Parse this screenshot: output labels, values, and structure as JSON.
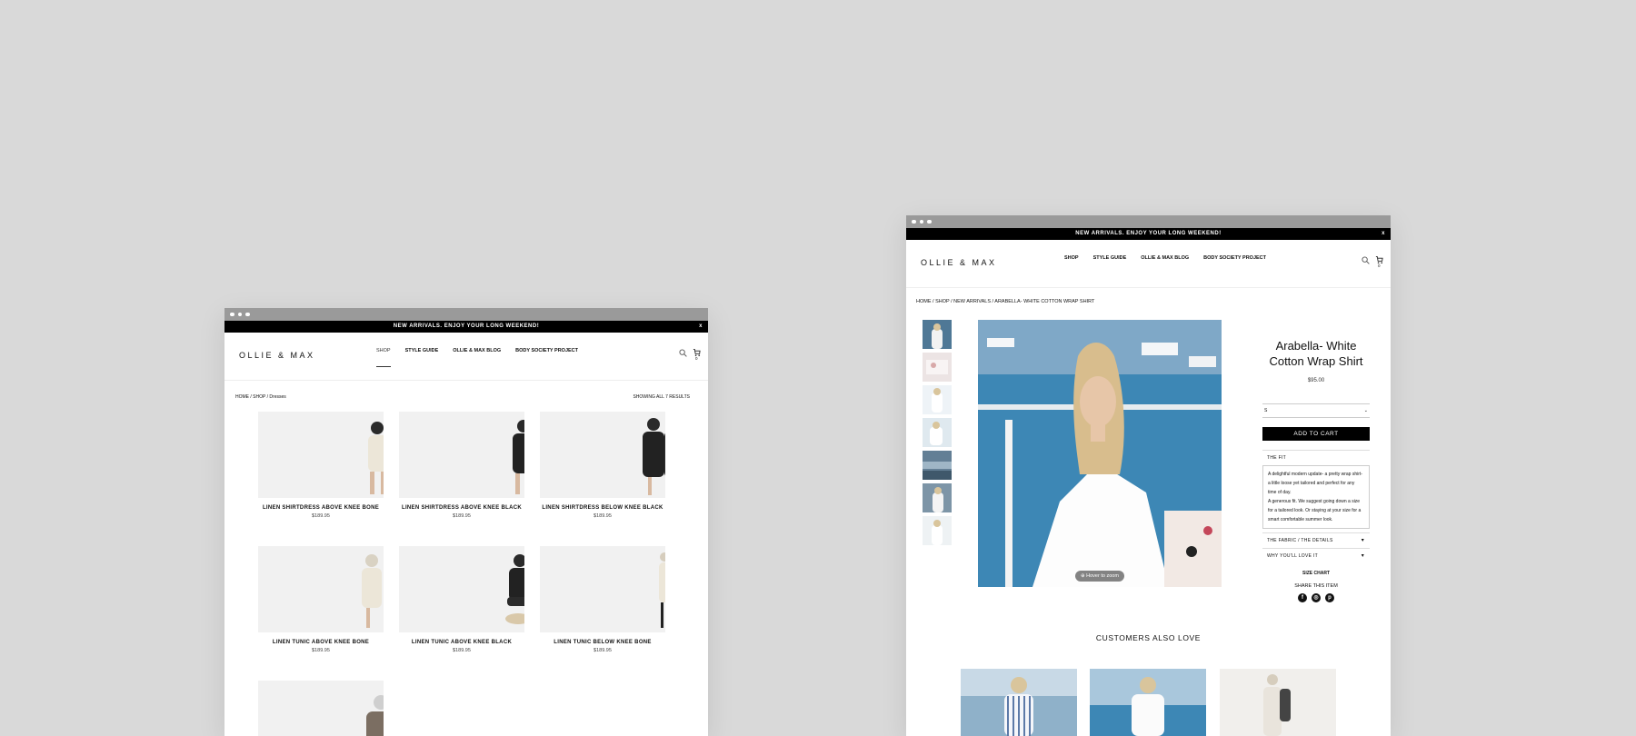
{
  "shared": {
    "announcement": "NEW ARRIVALS. ENJOY YOUR LONG WEEKEND!",
    "close_glyph": "x",
    "logo": "OLLIE & MAX",
    "nav": [
      "SHOP",
      "STYLE GUIDE",
      "OLLIE & MAX BLOG",
      "BODY SOCIETY PROJECT"
    ],
    "cart_count": "0",
    "icons": [
      "search-icon",
      "cart-icon"
    ]
  },
  "shop_page": {
    "breadcrumb": "HOME / SHOP / Dresses",
    "results": "SHOWING ALL 7 RESULTS",
    "products": [
      {
        "name": "LINEN SHIRTDRESS ABOVE KNEE BONE",
        "price": "$189.95"
      },
      {
        "name": "LINEN SHIRTDRESS ABOVE KNEE BLACK",
        "price": "$189.95"
      },
      {
        "name": "LINEN SHIRTDRESS BELOW KNEE BLACK",
        "price": "$189.95"
      },
      {
        "name": "LINEN TUNIC ABOVE KNEE BONE",
        "price": "$189.95"
      },
      {
        "name": "LINEN TUNIC ABOVE KNEE BLACK",
        "price": "$189.95"
      },
      {
        "name": "LINEN TUNIC BELOW KNEE BONE",
        "price": "$189.95"
      }
    ]
  },
  "product_page": {
    "breadcrumb": "HOME / SHOP / NEW ARRIVALS / ARABELLA- WHITE COTTON WRAP SHIRT",
    "title_line1": "Arabella- White",
    "title_line2": "Cotton Wrap Shirt",
    "price": "$95.00",
    "size_value": "S",
    "add_to_cart": "ADD TO CART",
    "zoom_hint": "Hover to zoom",
    "accordion": {
      "fit": "THE FIT",
      "fit_text_1": "A delightful modern update- a pretty wrap shirt- a little loose yet tailored and perfect for any time of day.",
      "fit_text_2": "A generous fit. We suggest going down a size for a tailored look. Or staying at your size for a smart comfortable summer look.",
      "fabric": "THE FABRIC / THE DETAILS",
      "why": "WHY YOU'LL LOVE IT"
    },
    "size_chart": "SIZE CHART",
    "share": "SHARE THIS ITEM",
    "socials": [
      "facebook-icon",
      "instagram-icon",
      "pinterest-icon"
    ],
    "also_love": "CUSTOMERS ALSO LOVE"
  }
}
